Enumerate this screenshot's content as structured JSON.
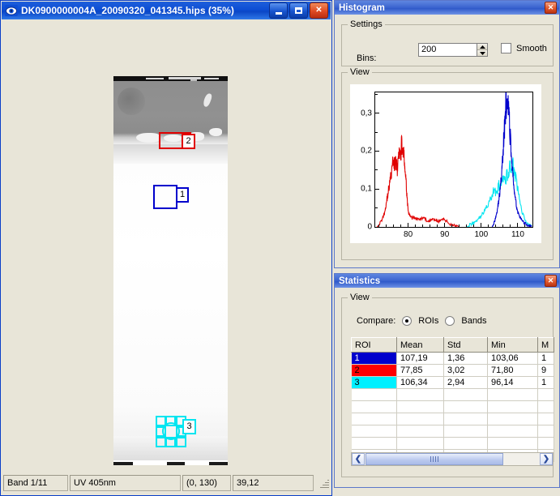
{
  "image_window": {
    "title": "DK0900000004A_20090320_041345.hips (35%)",
    "icon": "eye-icon",
    "buttons": {
      "minimize": "_",
      "maximize": "□",
      "close": "✕"
    },
    "status": {
      "band": "Band 1/11",
      "wavelength": "UV 405nm",
      "range": "(0, 130)",
      "value": "39,12"
    },
    "rois": [
      {
        "id": "1",
        "color": "#0000cc",
        "shape": "rectangle"
      },
      {
        "id": "2",
        "color": "#e00000",
        "shape": "rectangle"
      },
      {
        "id": "3",
        "color": "#00e5f0",
        "shape": "ellipse"
      }
    ]
  },
  "histogram": {
    "title": "Histogram",
    "close_label": "✕",
    "settings_group": "Settings",
    "bins_label": "Bins:",
    "bins_value": "200",
    "bins_placeholder": "200",
    "spin_up": "▲",
    "spin_down": "▼",
    "smooth_label": "Smooth",
    "smooth_checked": false,
    "view_group": "View"
  },
  "statistics": {
    "title": "Statistics",
    "close_label": "✕",
    "view_group": "View",
    "compare_label": "Compare:",
    "options": [
      {
        "label": "ROIs",
        "selected": true
      },
      {
        "label": "Bands",
        "selected": false
      }
    ],
    "columns": [
      "ROI",
      "Mean",
      "Std",
      "Min",
      "M"
    ],
    "rows": [
      {
        "roi": "1",
        "color": "#0000cc",
        "text_color": "#ffffff",
        "mean": "107,19",
        "std": "1,36",
        "min": "103,06",
        "max": "1"
      },
      {
        "roi": "2",
        "color": "#ff0000",
        "text_color": "#000000",
        "mean": "77,85",
        "std": "3,02",
        "min": "71,80",
        "max": "9"
      },
      {
        "roi": "3",
        "color": "#00f0ff",
        "text_color": "#000000",
        "mean": "106,34",
        "std": "2,94",
        "min": "96,14",
        "max": "1"
      }
    ],
    "scroll_left": "❮",
    "scroll_right": "❯"
  },
  "chart_data": {
    "type": "line",
    "title": "",
    "xlabel": "",
    "ylabel": "",
    "xlim": [
      71,
      114
    ],
    "ylim": [
      0,
      0.355
    ],
    "xticks": [
      80,
      90,
      100,
      110
    ],
    "xtick_labels": [
      "80",
      "90",
      "100",
      "110"
    ],
    "yticks": [
      0,
      0.1,
      0.2,
      0.3
    ],
    "ytick_labels": [
      "0",
      "0,1",
      "0,2",
      "0,3"
    ],
    "grid": false,
    "legend": "none",
    "series": [
      {
        "name": "ROI 2 (red)",
        "color": "#e00000",
        "x": [
          71.5,
          72.5,
          73.5,
          74.0,
          74.5,
          75.0,
          75.5,
          76.0,
          76.3,
          76.6,
          77.0,
          77.3,
          77.6,
          77.9,
          78.2,
          78.5,
          78.8,
          79.1,
          79.4,
          79.7,
          80.0,
          80.4,
          81.0,
          81.6,
          82.2,
          83.0,
          84.0,
          85.0,
          86.0,
          87.0,
          88.0,
          89.0,
          90.0,
          91.0,
          92.0,
          93.0,
          94.0
        ],
        "y": [
          0.003,
          0.012,
          0.035,
          0.062,
          0.09,
          0.118,
          0.148,
          0.178,
          0.16,
          0.182,
          0.15,
          0.172,
          0.196,
          0.178,
          0.222,
          0.205,
          0.19,
          0.16,
          0.12,
          0.08,
          0.04,
          0.03,
          0.024,
          0.026,
          0.022,
          0.02,
          0.024,
          0.018,
          0.016,
          0.02,
          0.014,
          0.018,
          0.02,
          0.01,
          0.006,
          0.003,
          0.001
        ]
      },
      {
        "name": "ROI 3 (cyan)",
        "color": "#00e5f0",
        "x": [
          96.0,
          97.0,
          98.0,
          99.0,
          100.0,
          101.0,
          102.0,
          102.8,
          103.5,
          104.2,
          104.8,
          105.4,
          106.0,
          106.5,
          107.0,
          107.4,
          107.8,
          108.2,
          108.6,
          109.0,
          109.6,
          110.2,
          111.0,
          112.0,
          113.0,
          113.8
        ],
        "y": [
          0.002,
          0.006,
          0.012,
          0.02,
          0.03,
          0.044,
          0.062,
          0.078,
          0.1,
          0.088,
          0.11,
          0.102,
          0.128,
          0.118,
          0.14,
          0.132,
          0.158,
          0.15,
          0.165,
          0.148,
          0.12,
          0.085,
          0.045,
          0.018,
          0.006,
          0.002
        ]
      },
      {
        "name": "ROI 1 (blue)",
        "color": "#0000cc",
        "x": [
          103.0,
          103.6,
          104.0,
          104.4,
          104.8,
          105.2,
          105.6,
          105.9,
          106.2,
          106.5,
          106.8,
          107.1,
          107.4,
          107.7,
          108.0,
          108.3,
          108.6,
          109.0,
          109.4,
          109.8,
          110.3,
          110.9,
          111.6,
          112.4,
          113.2,
          113.8
        ],
        "y": [
          0.004,
          0.012,
          0.028,
          0.046,
          0.072,
          0.1,
          0.142,
          0.186,
          0.24,
          0.288,
          0.33,
          0.3,
          0.322,
          0.27,
          0.23,
          0.18,
          0.14,
          0.1,
          0.068,
          0.046,
          0.03,
          0.02,
          0.012,
          0.006,
          0.003,
          0.001
        ]
      }
    ]
  }
}
